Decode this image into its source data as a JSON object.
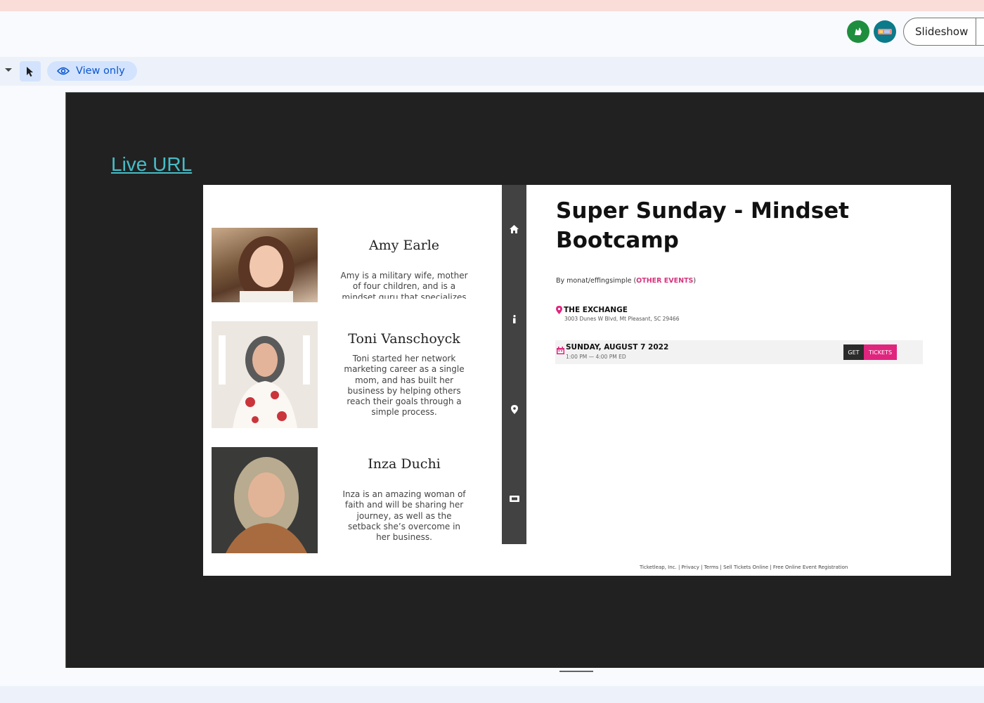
{
  "header": {
    "slideshow_label": "Slideshow",
    "collaborators": [
      {
        "name": "anonymous-animal-avatar",
        "color": "#1e8e3e"
      },
      {
        "name": "anonymous-animal-avatar",
        "color": "#0b7a8a"
      }
    ]
  },
  "toolbar": {
    "view_only_label": "View only"
  },
  "slide": {
    "link_text": "Live URL",
    "screenshot": {
      "speakers": [
        {
          "name": "Amy Earle",
          "bio": "Amy is a military wife, mother of four children, and is a mindset guru that specializes"
        },
        {
          "name": "Toni Vanschoyck",
          "bio": "Toni started her network marketing career as a single mom, and has built her business by helping others reach their goals through a simple process."
        },
        {
          "name": "Inza Duchi",
          "bio": "Inza is an amazing woman of faith and will be sharing her journey, as well as the setback she’s overcome in her business."
        }
      ],
      "event": {
        "title": "Super Sunday - Mindset Bootcamp",
        "byline_prefix": "By monat/effingsimple (",
        "byline_link": "OTHER EVENTS",
        "byline_suffix": ")",
        "venue_name": "THE EXCHANGE",
        "venue_address": "3003 Dunes W Blvd, Mt Pleasant, SC 29466",
        "date": "SUNDAY, AUGUST 7 2022",
        "time": "1:00 PM — 4:00 PM ED",
        "get_label": "GET",
        "tickets_label": "TICKETS",
        "accent_color": "#e0257f"
      },
      "footer": "Ticketleap, Inc. | Privacy | Terms | Sell Tickets Online | Free Online Event Registration"
    }
  }
}
